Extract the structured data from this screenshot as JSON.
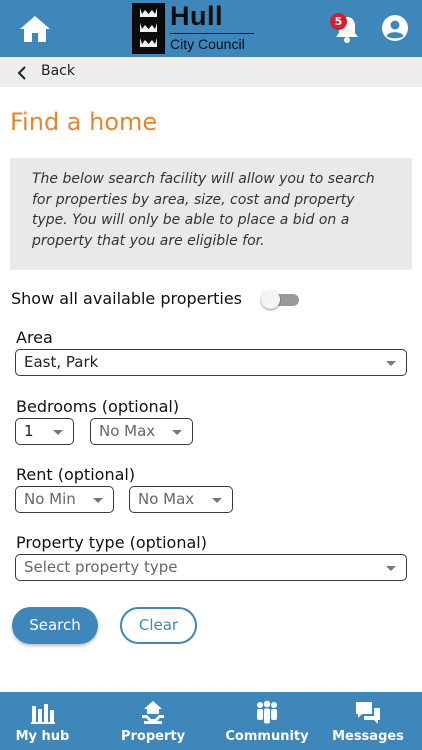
{
  "header": {
    "logo_name": "Hull",
    "logo_sub": "City Council",
    "notification_count": "5"
  },
  "back": {
    "label": "Back"
  },
  "page": {
    "title": "Find a home",
    "info": "The below search facility will allow you to search for properties by area, size, cost and property type. You will only be able to place a bid on a property that you are eligible for."
  },
  "filters": {
    "show_all_label": "Show all available properties",
    "show_all_on": false,
    "area": {
      "label": "Area",
      "value": "East, Park"
    },
    "bedrooms": {
      "label": "Bedrooms (optional)",
      "min_value": "1",
      "max_value": "No Max"
    },
    "rent": {
      "label": "Rent (optional)",
      "min_value": "No Min",
      "max_value": "No Max"
    },
    "property_type": {
      "label": "Property type (optional)",
      "placeholder": "Select property type"
    }
  },
  "actions": {
    "search_label": "Search",
    "clear_label": "Clear"
  },
  "nav": {
    "items": [
      {
        "label": "My hub",
        "icon": "hub-icon"
      },
      {
        "label": "Property",
        "icon": "property-icon"
      },
      {
        "label": "Community",
        "icon": "community-icon"
      },
      {
        "label": "Messages",
        "icon": "messages-icon"
      }
    ]
  },
  "colors": {
    "brand": "#3d87bb",
    "title": "#e2892d",
    "badge": "#d71f27"
  }
}
